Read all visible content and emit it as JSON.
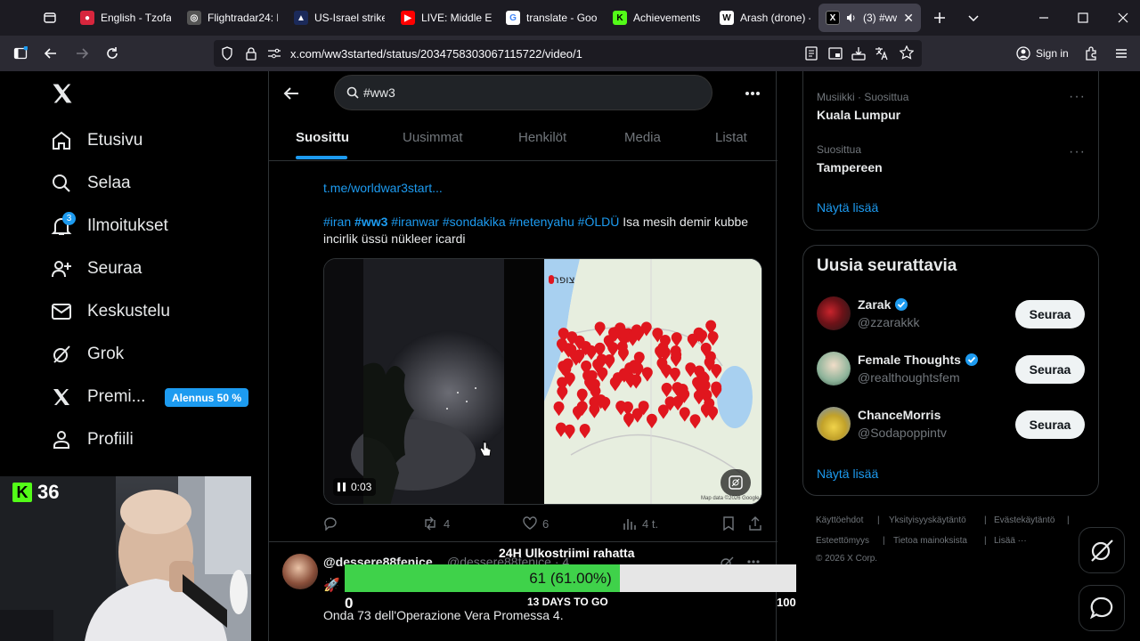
{
  "browser": {
    "tabs": [
      {
        "title": "English - Tzofar",
        "fav_color": "#d7263d",
        "fav_glyph": "●"
      },
      {
        "title": "Flightradar24: L",
        "fav_color": "#555555",
        "fav_glyph": "◎"
      },
      {
        "title": "US-Israel strikes",
        "fav_color": "#1b2a5a",
        "fav_glyph": "▲"
      },
      {
        "title": "LIVE: Middle Ea",
        "fav_color": "#ff0000",
        "fav_glyph": "▶"
      },
      {
        "title": "translate - Goo",
        "fav_color": "#ffffff",
        "fav_glyph": "G"
      },
      {
        "title": "Achievements -",
        "fav_color": "#53fc18",
        "fav_glyph": "K"
      },
      {
        "title": "Arash (drone) -",
        "fav_color": "#ffffff",
        "fav_glyph": "W"
      },
      {
        "title": "(3) #ww",
        "fav_color": "#000000",
        "fav_glyph": "X"
      }
    ],
    "url": "x.com/ww3started/status/2034758303067115722/video/1",
    "sign_in": "Sign in"
  },
  "sidebar": {
    "items": [
      {
        "label": "Etusivu",
        "icon": "home-icon"
      },
      {
        "label": "Selaa",
        "icon": "search-icon"
      },
      {
        "label": "Ilmoitukset",
        "icon": "bell-icon"
      },
      {
        "label": "Seuraa",
        "icon": "add-person-icon"
      },
      {
        "label": "Keskustelu",
        "icon": "mail-icon"
      },
      {
        "label": "Grok",
        "icon": "grok-icon"
      },
      {
        "label": "Premi...",
        "icon": "x-premium-icon"
      },
      {
        "label": "Profiili",
        "icon": "person-icon"
      }
    ],
    "notifications_count": "3",
    "premium_badge": "Alennus 50 %"
  },
  "center": {
    "search_value": "#ww3",
    "tabs": [
      "Suosittu",
      "Uusimmat",
      "Henkilöt",
      "Media",
      "Listat"
    ],
    "tweet1": {
      "link": "t.me/worldwar3start...",
      "tag_iran": "#iran",
      "tag_ww3": "#ww3",
      "tag_iranwar": "#iranwar",
      "tag_sondakika": "#sondakika",
      "tag_netenyahu": "#netenyahu",
      "tag_oldu": "#ÖLDÜ",
      "text": " Isa mesih demir kubbe incirlik üssü nükleer icardi",
      "video_time": "0:03",
      "map_label": "צופר",
      "map_credit": "Map data ©2026 Google",
      "replies": "",
      "retweets": "4",
      "likes": "6",
      "views": "4 t."
    },
    "tweet2": {
      "name": "@dessere88fenice",
      "handle": "@dessere88fenice · 4",
      "text": "Onda 73 dell'Operazione Vera Promessa 4."
    }
  },
  "right": {
    "trends": [
      {
        "meta": "Musiikki · Suosittua",
        "name": "Kuala Lumpur"
      },
      {
        "meta": "Suosittua",
        "name": "Tampereen"
      }
    ],
    "trends_more": "Näytä lisää",
    "follow_title": "Uusia seurattavia",
    "follow": [
      {
        "name": "Zarak",
        "handle": "@zzarakkk",
        "button": "Seuraa"
      },
      {
        "name": "Female Thoughts",
        "handle": "@realthoughtsfem",
        "button": "Seuraa"
      },
      {
        "name": "ChanceMorris",
        "handle": "@Sodapoppintv",
        "button": "Seuraa"
      }
    ],
    "follow_more": "Näytä lisää",
    "footer": {
      "terms": "Käyttöehdot",
      "privacy": "Yksityisyyskäytäntö",
      "cookies": "Evästekäytäntö",
      "accessibility": "Esteettömyys",
      "ads": "Tietoa mainoksista",
      "more": "Lisää ···",
      "copyright": "© 2026 X Corp."
    }
  },
  "overlay": {
    "kick_count": "36",
    "sub_goal_title": "24H Ulkostriimi rahatta",
    "sub_goal_label": "61 (61.00%)",
    "sub_goal_progress": 0.61,
    "sub_goal_min": "0",
    "sub_goal_max": "100",
    "sub_goal_days": "13 DAYS TO GO"
  },
  "colors": {
    "accent": "#1d9bf0",
    "goal_fill": "#3fd24a",
    "kick_green": "#53fc18"
  }
}
